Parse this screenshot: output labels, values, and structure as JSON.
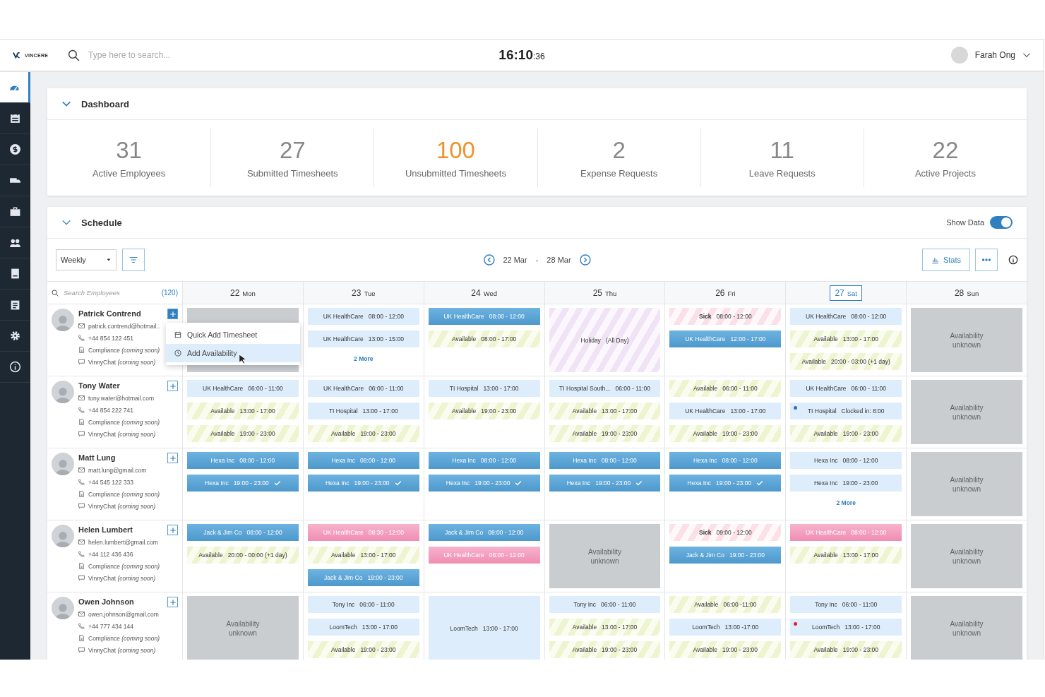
{
  "topbar": {
    "logo": "VINCERE",
    "search": {
      "placeholder": "Type here to search..."
    },
    "clock": {
      "time": "16:10",
      "seconds": ":36"
    },
    "user": {
      "name": "Farah Ong"
    }
  },
  "sidebar": {
    "items": [
      {
        "selected": true
      },
      {
        "selected": false
      },
      {
        "selected": false
      },
      {
        "selected": false
      },
      {
        "selected": false
      },
      {
        "selected": false
      },
      {
        "selected": false
      },
      {
        "selected": false
      },
      {
        "selected": false
      },
      {
        "selected": false
      }
    ]
  },
  "dashboard": {
    "title": "Dashboard",
    "expanded": true,
    "stats": [
      {
        "value": "31",
        "label": "Active Employees",
        "highlight": false
      },
      {
        "value": "27",
        "label": "Submitted Timesheets",
        "highlight": false
      },
      {
        "value": "100",
        "label": "Unsubmitted Timesheets",
        "highlight": true
      },
      {
        "value": "2",
        "label": "Expense Requests",
        "highlight": false
      },
      {
        "value": "11",
        "label": "Leave Requests",
        "highlight": false
      },
      {
        "value": "22",
        "label": "Active Projects",
        "highlight": false
      }
    ]
  },
  "schedule": {
    "title": "Schedule",
    "expanded": true,
    "show_data": {
      "label": "Show Data",
      "on": true
    },
    "view": {
      "value": "Weekly"
    },
    "range": {
      "start": "22 Mar",
      "separator": "-",
      "end": "28 Mar"
    },
    "stats_button": "Stats",
    "search": {
      "placeholder": "Search Employees",
      "count": "(120)"
    },
    "days": [
      {
        "date": "22",
        "weekday": "Mon",
        "selected": false
      },
      {
        "date": "23",
        "weekday": "Tue",
        "selected": false
      },
      {
        "date": "24",
        "weekday": "Wed",
        "selected": false
      },
      {
        "date": "25",
        "weekday": "Thu",
        "selected": false
      },
      {
        "date": "26",
        "weekday": "Fri",
        "selected": false
      },
      {
        "date": "27",
        "weekday": "Sat",
        "selected": true
      },
      {
        "date": "28",
        "weekday": "Sun",
        "selected": false
      }
    ],
    "employees": [
      {
        "name": "Patrick Contrend",
        "email": "patrick.contrend@hotmail..",
        "phone": "+44 854 122 451",
        "compliance": "Compliance *(coming soon)*",
        "chat": "VinnyChat *(coming soon)*",
        "menu_open": true,
        "menu": [
          {
            "label": "Quick Add Timesheet",
            "selected": false
          },
          {
            "label": "Add Availability",
            "selected": true
          }
        ],
        "days": [
          [
            {
              "kind": "unknown"
            }
          ],
          [
            {
              "kind": "booked",
              "label": "UK HealthCare",
              "time": "08:00 - 12:00"
            },
            {
              "kind": "booked",
              "label": "UK HealthCare",
              "time": "13:00 - 15:00"
            },
            {
              "kind": "more",
              "label": "2 More"
            }
          ],
          [
            {
              "kind": "assigned",
              "label": "UK HealthCare",
              "time": "08:00 - 12:00",
              "checked": false
            },
            {
              "kind": "available",
              "label": "Available",
              "time": "08:00 - 17:00"
            }
          ],
          [
            {
              "kind": "holiday",
              "label": "Holiday",
              "time": "(All Day)"
            }
          ],
          [
            {
              "kind": "sick",
              "label": "Sick",
              "time": "08:00 - 12:00"
            },
            {
              "kind": "assigned",
              "label": "UK HealthCare",
              "time": "12:00 - 17:00",
              "checked": false
            }
          ],
          [
            {
              "kind": "booked",
              "label": "UK HealthCare",
              "time": "08:00 - 12:00"
            },
            {
              "kind": "available",
              "label": "Available",
              "time": "13:00 - 17:00"
            },
            {
              "kind": "available",
              "label": "Available",
              "time": "20:00 - 03:00 (+1 day)"
            }
          ],
          [
            {
              "kind": "unknown",
              "label": "Availability unknown"
            }
          ]
        ]
      },
      {
        "name": "Tony Water",
        "email": "tony.water@hotmail.com",
        "phone": "+44 854 222 741",
        "compliance": "Compliance *(coming soon)*",
        "chat": "VinnyChat *(coming soon)*",
        "menu_open": false,
        "days": [
          [
            {
              "kind": "booked",
              "label": "UK HealthCare",
              "time": "06:00 - 11:00"
            },
            {
              "kind": "available",
              "label": "Available",
              "time": "13:00 - 17:00"
            },
            {
              "kind": "available",
              "label": "Available",
              "time": "19:00 - 23:00"
            }
          ],
          [
            {
              "kind": "booked",
              "label": "UK HealthCare",
              "time": "06:00 - 11:00"
            },
            {
              "kind": "booked",
              "label": "TI Hospital",
              "time": "13:00 - 17:00"
            },
            {
              "kind": "available",
              "label": "Available",
              "time": "19:00 - 23:00"
            }
          ],
          [
            {
              "kind": "booked",
              "label": "TI Hospital",
              "time": "13:00 - 17:00"
            },
            {
              "kind": "available",
              "label": "Available",
              "time": "19:00 - 23:00"
            }
          ],
          [
            {
              "kind": "booked",
              "label": "TI Hospital South...",
              "time": "06:00 - 11:00"
            },
            {
              "kind": "available",
              "label": "Available",
              "time": "13:00 - 17:00"
            },
            {
              "kind": "available",
              "label": "Available",
              "time": "19:00 - 23:00"
            }
          ],
          [
            {
              "kind": "available",
              "label": "Available",
              "time": "06:00 - 11:00"
            },
            {
              "kind": "booked",
              "label": "UK HealthCare",
              "time": "13:00 - 17:00"
            },
            {
              "kind": "available",
              "label": "Available",
              "time": "19:00 - 23:00"
            }
          ],
          [
            {
              "kind": "booked",
              "label": "UK HealthCare",
              "time": "06:00 - 11:00"
            },
            {
              "kind": "booked",
              "label": "TI Hospital",
              "time": "Clocked in: 8:00",
              "color": "#2a6fc9"
            },
            {
              "kind": "available",
              "label": "Available",
              "time": "19:00 - 23:00"
            }
          ],
          [
            {
              "kind": "unknown",
              "label": "Availability unknown"
            }
          ]
        ]
      },
      {
        "name": "Matt Lung",
        "email": "matt.lung@gmail.com",
        "phone": "+44 545 122 333",
        "compliance": "Compliance *(coming soon)*",
        "chat": "VinnyChat *(coming soon)*",
        "menu_open": false,
        "days": [
          [
            {
              "kind": "assigned",
              "label": "Hexa Inc",
              "time": "08:00 - 12:00",
              "checked": false
            },
            {
              "kind": "assigned",
              "label": "Hexa Inc",
              "time": "19:00 - 23:00",
              "checked": true
            }
          ],
          [
            {
              "kind": "assigned",
              "label": "Hexa Inc",
              "time": "08:00 - 12:00",
              "checked": false
            },
            {
              "kind": "assigned",
              "label": "Hexa Inc",
              "time": "19:00 - 23:00",
              "checked": true
            }
          ],
          [
            {
              "kind": "assigned",
              "label": "Hexa Inc",
              "time": "08:00 - 12:00",
              "checked": false
            },
            {
              "kind": "assigned",
              "label": "Hexa Inc",
              "time": "19:00 - 23:00",
              "checked": true
            }
          ],
          [
            {
              "kind": "assigned",
              "label": "Hexa Inc",
              "time": "08:00 - 12:00",
              "checked": false
            },
            {
              "kind": "assigned",
              "label": "Hexa Inc",
              "time": "19:00 - 23:00",
              "checked": true
            }
          ],
          [
            {
              "kind": "assigned",
              "label": "Hexa Inc",
              "time": "08:00 - 12:00",
              "checked": false
            },
            {
              "kind": "assigned",
              "label": "Hexa Inc",
              "time": "19:00 - 23:00",
              "checked": true
            }
          ],
          [
            {
              "kind": "booked",
              "label": "Hexa Inc",
              "time": "08:00 - 12:00"
            },
            {
              "kind": "booked",
              "label": "Hexa Inc",
              "time": "19:00 - 23:00"
            },
            {
              "kind": "more",
              "label": "2 More"
            }
          ],
          [
            {
              "kind": "unknown",
              "label": "Availability unknown"
            }
          ]
        ]
      },
      {
        "name": "Helen Lumbert",
        "email": "helen.lumbert@gmail.com",
        "phone": "+44 112 436 436",
        "compliance": "Compliance *(coming soon)*",
        "chat": "VinnyChat *(coming soon)*",
        "menu_open": false,
        "days": [
          [
            {
              "kind": "assigned",
              "label": "Jack & Jim Co",
              "time": "08:00 - 12:00",
              "checked": false
            },
            {
              "kind": "available",
              "label": "Available",
              "time": "20:00 - 00:00 (+1 day)"
            }
          ],
          [
            {
              "kind": "pending",
              "label": "UK HealthCare",
              "time": "08:30 - 12:00"
            },
            {
              "kind": "available",
              "label": "Available",
              "time": "13:00 - 17:00"
            },
            {
              "kind": "assigned",
              "label": "Jack & Jim Co",
              "time": "19:00 - 23:00",
              "checked": false
            }
          ],
          [
            {
              "kind": "assigned",
              "label": "Jack & Jim Co",
              "time": "08:00 - 12:00",
              "checked": false
            },
            {
              "kind": "pending",
              "label": "UK HealthCare",
              "time": "08:00 - 12:00"
            }
          ],
          [
            {
              "kind": "unknown",
              "label": "Availability unknown"
            }
          ],
          [
            {
              "kind": "sick",
              "label": "Sick",
              "time": "09:00 - 12:00"
            },
            {
              "kind": "assigned",
              "label": "Jack & Jim Co",
              "time": "19:00 - 23:00",
              "checked": false
            }
          ],
          [
            {
              "kind": "pending",
              "label": "UK HealthCare",
              "time": "08:00 - 12:00"
            },
            {
              "kind": "available",
              "label": "Available",
              "time": "13:00 - 17:00"
            }
          ],
          [
            {
              "kind": "unknown",
              "label": "Availability unknown"
            }
          ]
        ]
      },
      {
        "name": "Owen Johnson",
        "email": "owen.johnson@gmail.com",
        "phone": "+44 777 434 144",
        "compliance": "Compliance *(coming soon)*",
        "chat": "VinnyChat *(coming soon)*",
        "menu_open": false,
        "days": [
          [
            {
              "kind": "unknown",
              "label": "Availability unknown"
            }
          ],
          [
            {
              "kind": "booked",
              "label": "Tony Inc",
              "time": "06:00 - 11:00"
            },
            {
              "kind": "booked",
              "label": "LoomTech",
              "time": "13:00 - 17:00"
            },
            {
              "kind": "available",
              "label": "Available",
              "time": "19:00 - 23:00"
            }
          ],
          [
            {
              "kind": "allday",
              "label": "LoomTech",
              "time": "13:00 - 17:00"
            }
          ],
          [
            {
              "kind": "booked",
              "label": "Tony Inc",
              "time": "06:00 - 11:00"
            },
            {
              "kind": "available",
              "label": "Available",
              "time": "13:00 - 17:00"
            },
            {
              "kind": "available",
              "label": "Available",
              "time": "19:00 - 23:00"
            }
          ],
          [
            {
              "kind": "available",
              "label": "Available",
              "time": "06:00 -11:00"
            },
            {
              "kind": "booked",
              "label": "LoomTech",
              "time": "13:00 -17:00"
            },
            {
              "kind": "available",
              "label": "Available",
              "time": "19:00 - 23:00"
            }
          ],
          [
            {
              "kind": "booked",
              "label": "Tony Inc",
              "time": "06:00 - 11:00"
            },
            {
              "kind": "booked",
              "label": "LoomTech",
              "time": "13:00 - 17:00",
              "color": "#e0202a"
            },
            {
              "kind": "available",
              "label": "Available",
              "time": "19:00 - 23:00"
            }
          ],
          [
            {
              "kind": "unknown",
              "label": "Availability unknown"
            }
          ]
        ]
      }
    ]
  }
}
